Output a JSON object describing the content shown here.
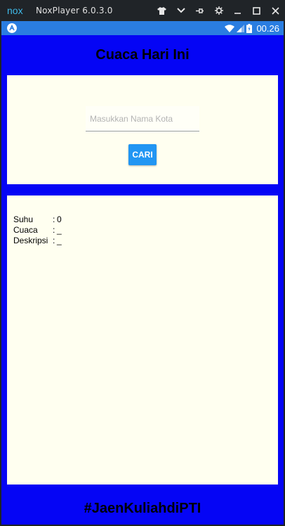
{
  "window": {
    "title": "NoxPlayer 6.0.3.0",
    "logo_text": "nox"
  },
  "statusbar": {
    "time": "00.26"
  },
  "app": {
    "header": "Cuaca Hari Ini",
    "search": {
      "placeholder": "Masukkan Nama Kota",
      "value": "",
      "button_label": "CARI"
    },
    "result": {
      "rows": [
        {
          "label": "Suhu",
          "sep": ":",
          "value": "0"
        },
        {
          "label": "Cuaca",
          "sep": ":",
          "value": "_"
        },
        {
          "label": "Deskripsi",
          "sep": ":",
          "value": "_"
        }
      ]
    },
    "footer": "#JaenKuliahdiPTI"
  },
  "colors": {
    "background": "#0505f5",
    "card": "#fffff0",
    "button": "#2196f3",
    "statusbar": "#2a7de1",
    "titlebar": "#202428"
  }
}
